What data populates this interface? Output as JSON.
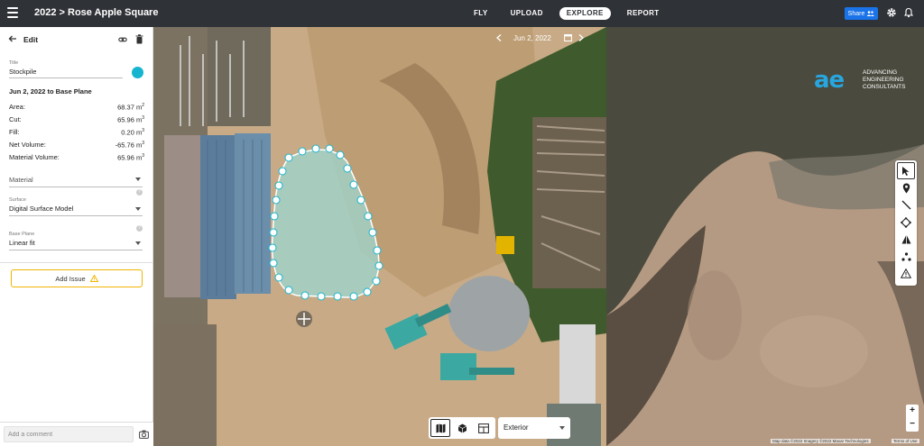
{
  "topbar": {
    "title": "2022 > Rose Apple Square",
    "nav": [
      {
        "label": "FLY",
        "active": false
      },
      {
        "label": "UPLOAD",
        "active": false
      },
      {
        "label": "EXPLORE",
        "active": true
      },
      {
        "label": "REPORT",
        "active": false
      }
    ],
    "share_label": "Share",
    "icons": [
      "menu-icon",
      "share-people-icon",
      "gear-icon",
      "bell-icon"
    ]
  },
  "panel": {
    "header": "Edit",
    "title_label": "Title",
    "title_value": "Stockpile",
    "accent_color": "#16b4cf",
    "date_range": "Jun 2, 2022 to Base Plane",
    "stats": [
      {
        "label": "Area:",
        "value": "68.37 m",
        "unit_exp": "2"
      },
      {
        "label": "Cut:",
        "value": "65.96 m",
        "unit_exp": "3"
      },
      {
        "label": "Fill:",
        "value": "0.20 m",
        "unit_exp": "3"
      },
      {
        "label": "Net Volume:",
        "value": "-65.76 m",
        "unit_exp": "3"
      },
      {
        "label": "Material Volume:",
        "value": "65.96 m",
        "unit_exp": "3"
      }
    ],
    "material_label": "Material",
    "surface_label": "Surface",
    "surface_value": "Digital Surface Model",
    "base_plane_label": "Base Plane",
    "base_plane_value": "Linear fit",
    "add_issue_label": "Add Issue",
    "comment_placeholder": "Add a comment"
  },
  "map": {
    "date": "Jun 2, 2022",
    "logo_mark": "ae",
    "logo_lines": [
      "ADVANCING",
      "ENGINEERING",
      "CONSULTANTS"
    ],
    "tools": [
      "pointer-icon",
      "marker-pin-icon",
      "line-icon",
      "area-icon",
      "volume-icon",
      "points-icon",
      "warning-icon"
    ],
    "view_modes": [
      "map-2d-icon",
      "3d-cube-icon",
      "split-view-icon"
    ],
    "layer_value": "Exterior",
    "zoom_in": "+",
    "zoom_out": "−",
    "attribution": "Map data ©2022 Imagery ©2022 Maxar Technologies",
    "terms": "Terms of Use"
  }
}
